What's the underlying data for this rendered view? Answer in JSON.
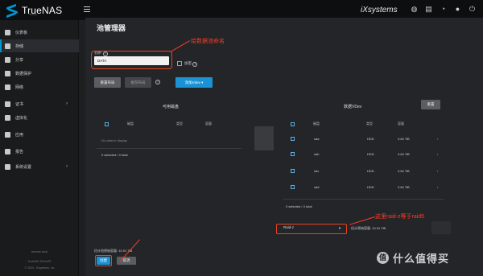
{
  "app": {
    "logo_text": "TrueNAS",
    "logo_sub": "SCALE",
    "vendor": "systems"
  },
  "sidebar": {
    "items": [
      {
        "label": "仪表板",
        "icon": "dashboard-icon",
        "active": false,
        "arrow": false
      },
      {
        "label": "存储",
        "icon": "storage-icon",
        "active": true,
        "arrow": false
      },
      {
        "label": "分享",
        "icon": "share-icon",
        "active": false,
        "arrow": false
      },
      {
        "label": "数据保护",
        "icon": "shield-icon",
        "active": false,
        "arrow": false
      },
      {
        "label": "网络",
        "icon": "network-icon",
        "active": false,
        "arrow": false
      },
      {
        "label": "证书",
        "icon": "key-icon",
        "active": false,
        "arrow": true
      },
      {
        "label": "虚拟化",
        "icon": "computer-icon",
        "active": false,
        "arrow": false
      },
      {
        "label": "应用",
        "icon": "apps-icon",
        "active": false,
        "arrow": false
      },
      {
        "label": "报告",
        "icon": "report-icon",
        "active": false,
        "arrow": false
      },
      {
        "label": "系统设置",
        "icon": "gear-icon",
        "active": false,
        "arrow": true
      }
    ],
    "footer": [
      "truenas.local",
      "TrueNAS SCALE®",
      "© 2023 - iXsystems, Inc"
    ]
  },
  "page": {
    "title": "池管理器",
    "name_label": "名称*",
    "name_value": "DATA",
    "encrypt_label": "加密",
    "reset_button": "重置布局",
    "suggest_button": "推荐布局",
    "add_vdev_button": "添加Vdev",
    "available_title": "可用磁盘",
    "data_vdev_title": "数据VDev",
    "remove_button": "重置",
    "no_data": "No data to display",
    "available_selected": "0 selected / 0 total",
    "vdev_selected": "0 selected / 4 total",
    "raid_value": "Raid-z",
    "vdev_capacity": "估计原始容量: 10.91 TiB",
    "total_capacity_label": "估计池原始容量:",
    "total_capacity_value": "10.91 TiB",
    "create_button": "创建",
    "cancel_button": "取消"
  },
  "columns": {
    "disk": "磁盘",
    "type": "类型",
    "capacity": "容量"
  },
  "vdev_disks": [
    {
      "name": "sda",
      "type": "HDD",
      "capacity": "3.64 TiB"
    },
    {
      "name": "sdb",
      "type": "HDD",
      "capacity": "3.64 TiB"
    },
    {
      "name": "sdc",
      "type": "HDD",
      "capacity": "3.64 TiB"
    },
    {
      "name": "sdd",
      "type": "HDD",
      "capacity": "3.64 TiB"
    }
  ],
  "annotations": {
    "name_note": "给数据池命名",
    "raid_note": "这里raid-z等于raid5"
  },
  "watermark": {
    "badge": "值",
    "text": "什么值得买"
  },
  "colors": {
    "accent": "#0095d5",
    "annotation": "#ff3b1f",
    "button_blue": "#1a93d6"
  }
}
